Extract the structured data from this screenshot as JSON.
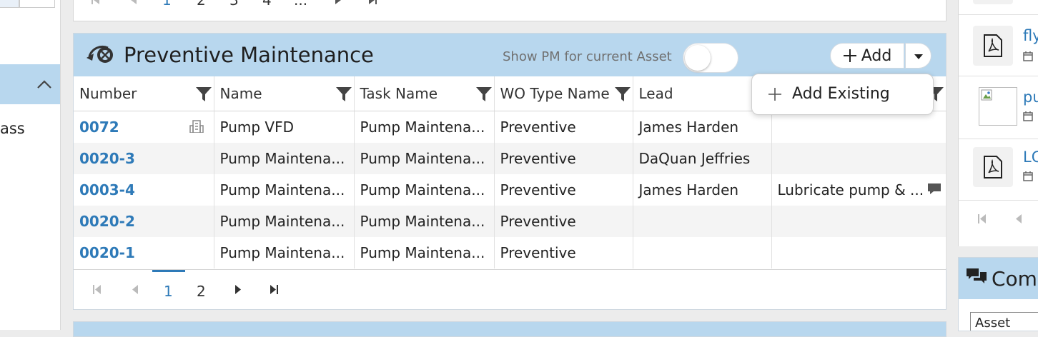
{
  "left": {
    "partial_text": "ass"
  },
  "prev_pager": {
    "pages": [
      "1",
      "2",
      "3",
      "4",
      "..."
    ]
  },
  "panel": {
    "title": "Preventive Maintenance",
    "toggle_label": "Show PM for current Asset",
    "add_label": "Add",
    "dropdown_item": "Add Existing",
    "columns": [
      "Number",
      "Name",
      "Task Name",
      "WO Type Name",
      "Lead",
      ""
    ],
    "rows": [
      {
        "number": "0072",
        "name": "Pump VFD",
        "task": "Pump Maintena...",
        "wo_type": "Preventive",
        "lead": "James Harden",
        "desc": "",
        "building_icon": true
      },
      {
        "number": "0020-3",
        "name": "Pump Maintena...",
        "task": "Pump Maintena...",
        "wo_type": "Preventive",
        "lead": "DaQuan Jeffries",
        "desc": ""
      },
      {
        "number": "0003-4",
        "name": "Pump Maintena...",
        "task": "Pump Maintena...",
        "wo_type": "Preventive",
        "lead": "James Harden",
        "desc": "Lubricate pump & ...",
        "comment_icon": true
      },
      {
        "number": "0020-2",
        "name": "Pump Maintena...",
        "task": "Pump Maintena...",
        "wo_type": "Preventive",
        "lead": "",
        "desc": ""
      },
      {
        "number": "0020-1",
        "name": "Pump Maintena...",
        "task": "Pump Maintena...",
        "wo_type": "Preventive",
        "lead": "",
        "desc": ""
      }
    ],
    "pager": {
      "pages": [
        "1",
        "2"
      ],
      "current": "1"
    }
  },
  "right": {
    "docs": [
      {
        "name": "fly",
        "icon": "pdf-icon"
      },
      {
        "name": "pu",
        "icon": "broken-image-icon"
      },
      {
        "name": "LC",
        "icon": "pdf-icon"
      }
    ],
    "comments_title": "Com",
    "comment_input": "Asset nee"
  },
  "colors": {
    "header": "#b8d7ee",
    "link": "#2e7ab8"
  }
}
